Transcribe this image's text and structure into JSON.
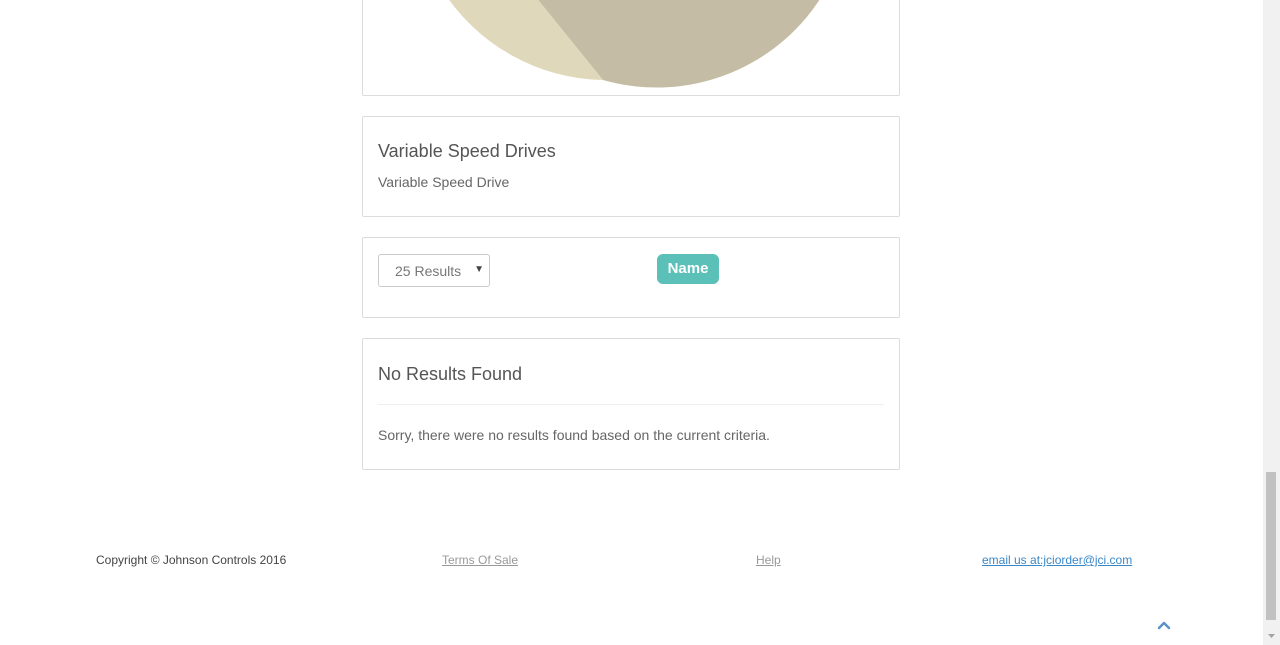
{
  "category": {
    "title": "Variable Speed Drives",
    "subtitle": "Variable Speed Drive"
  },
  "controls": {
    "page_size": "25 Results",
    "sort_label": "Name"
  },
  "results": {
    "title": "No Results Found",
    "message": "Sorry, there were no results found based on the current criteria."
  },
  "footer": {
    "copyright": "Copyright © Johnson Controls 2016",
    "terms": "Terms Of Sale",
    "help": "Help",
    "email": "email us at:jciorder@jci.com"
  },
  "icons": {
    "select_caret": "caret-down-icon",
    "back_to_top": "chevron-up-icon"
  },
  "colors": {
    "accent": "#5bc0b8",
    "link": "#3a87c8",
    "pie_light": "#e0d8ba",
    "pie_dark": "#c4bca4"
  }
}
